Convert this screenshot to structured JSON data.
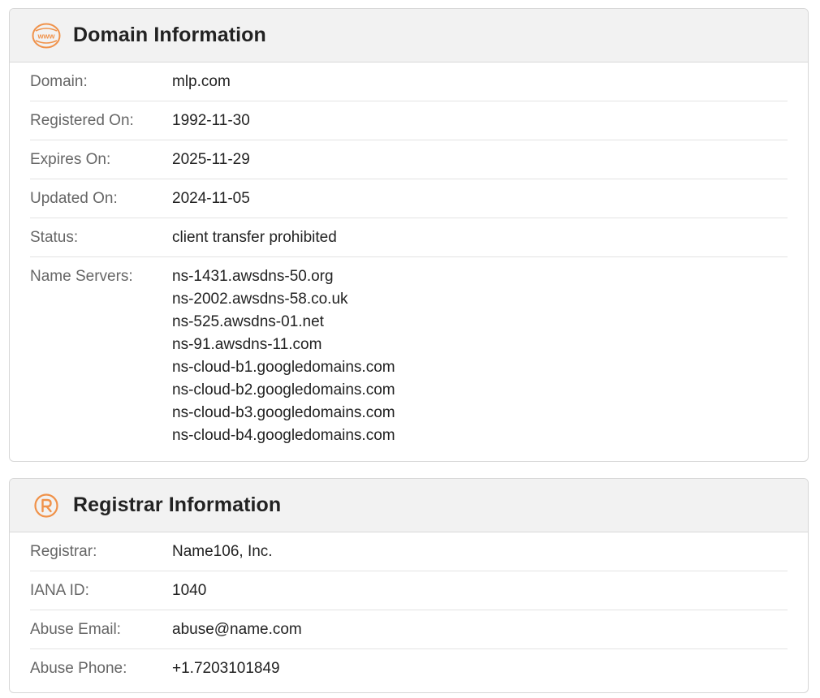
{
  "domain_card": {
    "title": "Domain Information",
    "icon": "www-icon",
    "accent": "#f0924a",
    "rows": [
      {
        "label": "Domain:",
        "value": "mlp.com"
      },
      {
        "label": "Registered On:",
        "value": "1992-11-30"
      },
      {
        "label": "Expires On:",
        "value": "2025-11-29"
      },
      {
        "label": "Updated On:",
        "value": "2024-11-05"
      },
      {
        "label": "Status:",
        "value": "client transfer prohibited"
      }
    ],
    "name_servers": {
      "label": "Name Servers:",
      "values": [
        "ns-1431.awsdns-50.org",
        "ns-2002.awsdns-58.co.uk",
        "ns-525.awsdns-01.net",
        "ns-91.awsdns-11.com",
        "ns-cloud-b1.googledomains.com",
        "ns-cloud-b2.googledomains.com",
        "ns-cloud-b3.googledomains.com",
        "ns-cloud-b4.googledomains.com"
      ]
    }
  },
  "registrar_card": {
    "title": "Registrar Information",
    "icon": "registered-icon",
    "rows": [
      {
        "label": "Registrar:",
        "value": "Name106, Inc."
      },
      {
        "label": "IANA ID:",
        "value": "1040"
      },
      {
        "label": "Abuse Email:",
        "value": "abuse@name.com"
      },
      {
        "label": "Abuse Phone:",
        "value": "+1.7203101849"
      }
    ]
  }
}
